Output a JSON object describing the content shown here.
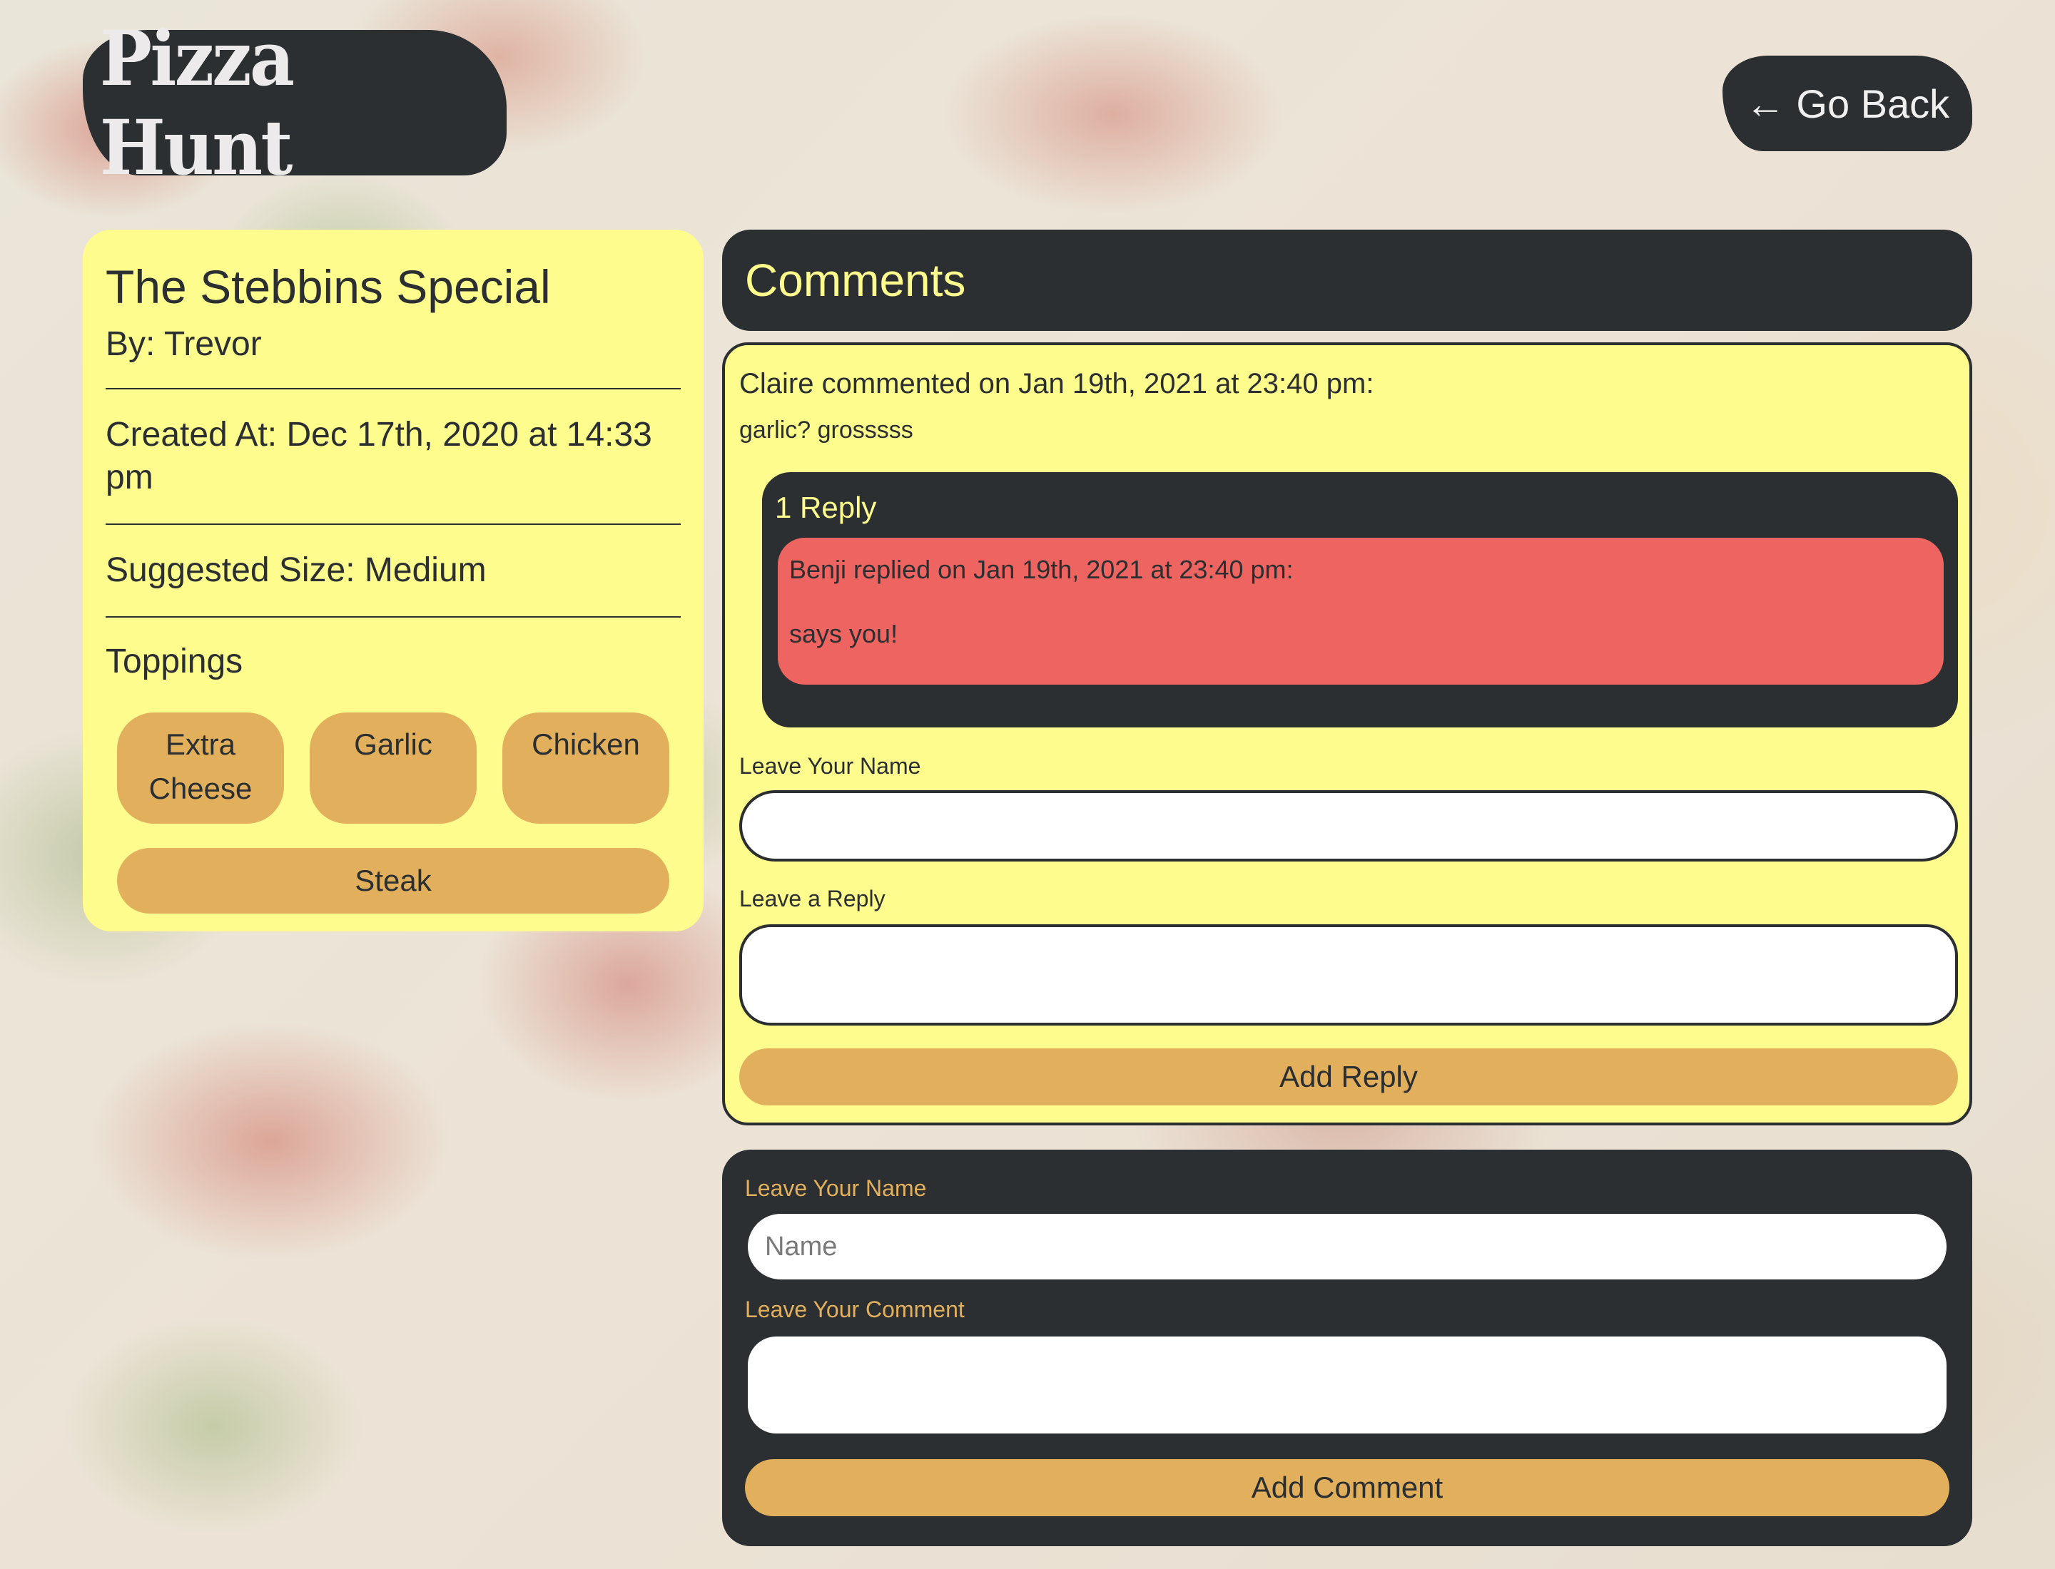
{
  "header": {
    "logo": "Pizza Hunt",
    "go_back": "← Go Back"
  },
  "pizza": {
    "name": "The Stebbins Special",
    "by": "By: Trevor",
    "created_at": "Created At: Dec 17th, 2020 at 14:33 pm",
    "size": "Suggested Size: Medium",
    "toppings_title": "Toppings",
    "toppings": [
      "Extra Cheese",
      "Garlic",
      "Chicken",
      "Steak"
    ]
  },
  "comments": {
    "title": "Comments",
    "items": [
      {
        "meta": "Claire commented on Jan 19th, 2021 at 23:40 pm:",
        "body": "garlic? grosssss",
        "reply_count": "1 Reply",
        "replies": [
          {
            "meta": "Benji replied on Jan 19th, 2021 at 23:40 pm:",
            "body": "says you!"
          }
        ],
        "reply_form": {
          "name_label": "Leave Your Name",
          "reply_label": "Leave a Reply",
          "submit": "Add Reply"
        }
      }
    ]
  },
  "new_comment": {
    "name_label": "Leave Your Name",
    "name_placeholder": "Name",
    "comment_label": "Leave Your Comment",
    "submit": "Add Comment"
  },
  "colors": {
    "dark": "#2b2f31",
    "yellow": "#fefc8c",
    "tan": "#e2b05c",
    "red": "#ee6461"
  }
}
